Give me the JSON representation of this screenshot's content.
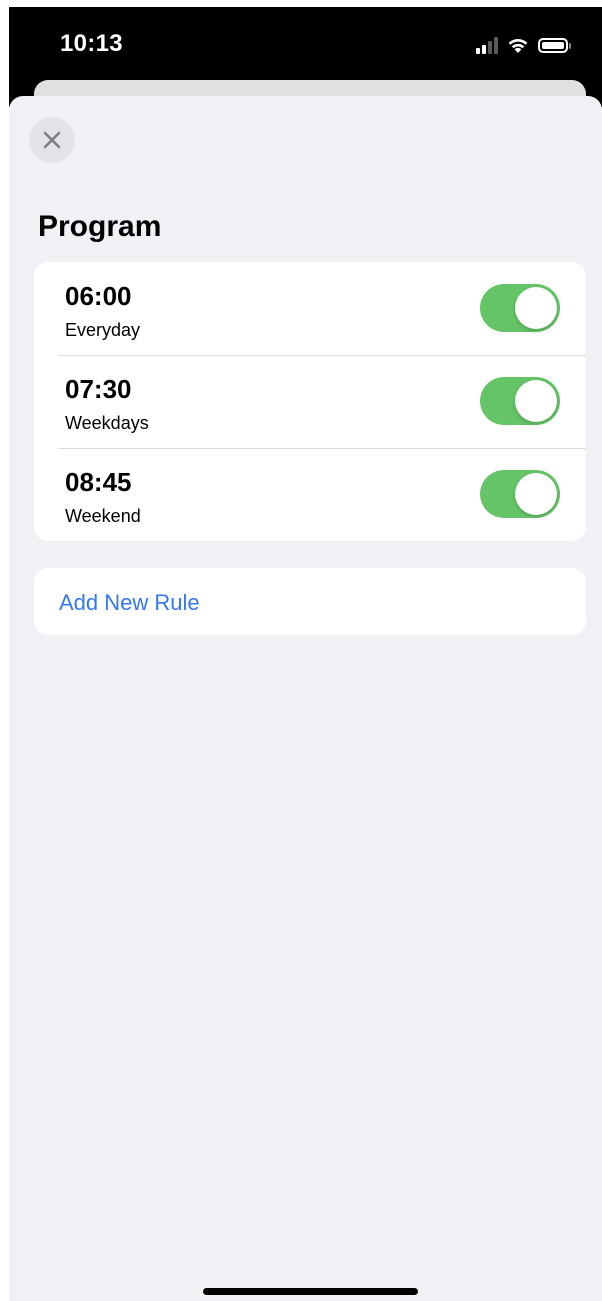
{
  "status_bar": {
    "time": "10:13",
    "icons": [
      "signal-icon",
      "wifi-icon",
      "battery-icon"
    ]
  },
  "sheet": {
    "close_icon": "close-icon",
    "title": "Program",
    "rules": [
      {
        "time": "06:00",
        "days": "Everyday",
        "enabled": true
      },
      {
        "time": "07:30",
        "days": "Weekdays",
        "enabled": true
      },
      {
        "time": "08:45",
        "days": "Weekend",
        "enabled": true
      }
    ],
    "add_rule_label": "Add New Rule"
  },
  "colors": {
    "toggle_on": "#65c466",
    "link": "#3478f6",
    "background": "#f0f0f5"
  }
}
